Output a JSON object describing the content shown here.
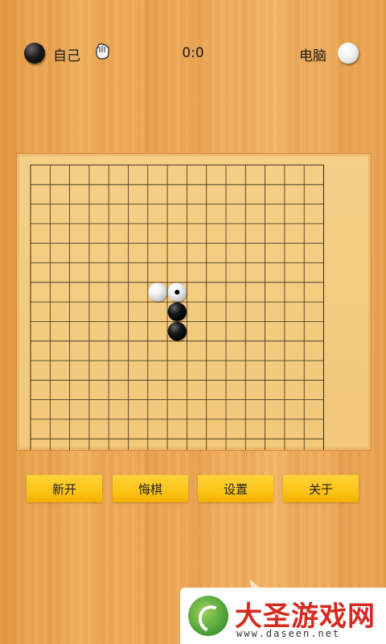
{
  "header": {
    "player_label": "自己",
    "player_stone": "black",
    "score": "0:0",
    "opponent_label": "电脑",
    "opponent_stone": "white",
    "turn_indicator_icon": "hand-pointer-icon"
  },
  "board": {
    "size": 15,
    "stones": [
      {
        "col": 6,
        "row": 6,
        "color": "white",
        "last_move": false
      },
      {
        "col": 7,
        "row": 6,
        "color": "white",
        "last_move": true
      },
      {
        "col": 7,
        "row": 7,
        "color": "black",
        "last_move": false
      },
      {
        "col": 7,
        "row": 8,
        "color": "black",
        "last_move": false
      }
    ]
  },
  "buttons": {
    "new_game": "新开",
    "undo": "悔棋",
    "settings": "设置",
    "about": "关于"
  },
  "watermark": {
    "title": "大圣游戏网",
    "url": "www.daseen.net"
  }
}
